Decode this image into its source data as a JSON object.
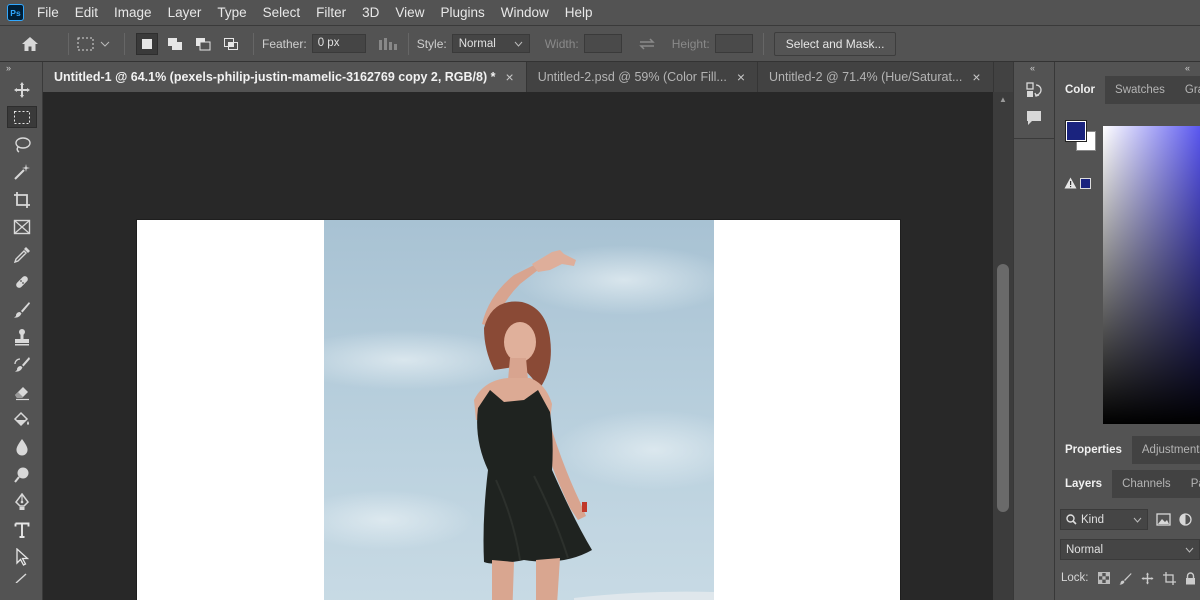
{
  "app": {
    "logo_text": "Ps"
  },
  "menu": [
    "File",
    "Edit",
    "Image",
    "Layer",
    "Type",
    "Select",
    "Filter",
    "3D",
    "View",
    "Plugins",
    "Window",
    "Help"
  ],
  "options": {
    "feather_label": "Feather:",
    "feather_value": "0 px",
    "style_label": "Style:",
    "style_value": "Normal",
    "width_label": "Width:",
    "height_label": "Height:",
    "select_mask_label": "Select and Mask..."
  },
  "tabs": [
    {
      "label": "Untitled-1 @ 64.1% (pexels-philip-justin-mamelic-3162769 copy 2, RGB/8) *",
      "active": true
    },
    {
      "label": "Untitled-2.psd @ 59% (Color Fill...",
      "active": false
    },
    {
      "label": "Untitled-2 @ 71.4% (Hue/Saturat...",
      "active": false
    }
  ],
  "tools": [
    "move",
    "marquee",
    "lasso",
    "magic-wand",
    "crop",
    "frame",
    "eyedropper",
    "healing",
    "brush",
    "stamp",
    "history-brush",
    "eraser",
    "paint-bucket",
    "blur",
    "dodge",
    "pen",
    "type",
    "path-select"
  ],
  "panels": {
    "color_tabs": [
      "Color",
      "Swatches",
      "Grad"
    ],
    "props_tabs": [
      "Properties",
      "Adjustments"
    ],
    "layers_tabs": [
      "Layers",
      "Channels",
      "Path"
    ],
    "kind_label": "Kind",
    "blend_mode": "Normal",
    "lock_label": "Lock:"
  },
  "colors": {
    "foreground": "#1a237e",
    "background": "#ffffff",
    "accent": "#31a8ff"
  }
}
